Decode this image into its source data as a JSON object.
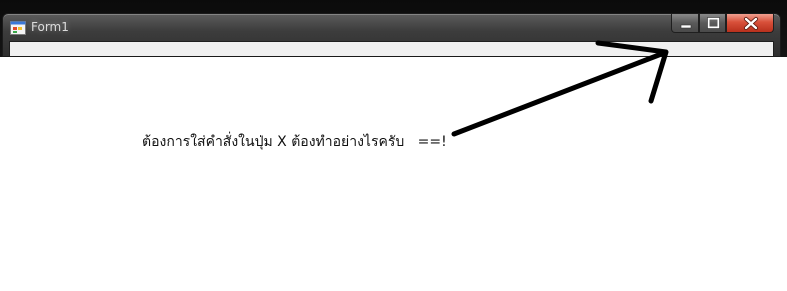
{
  "window": {
    "title": "Form1",
    "controls": {
      "minimize_icon": "minimize-icon",
      "maximize_icon": "maximize-icon",
      "close_icon": "close-icon"
    }
  },
  "annotation": {
    "question": "ต้องการใส่คำสั่งในปุ่ม X ต้องทำอย่างไรครับ   ==!"
  },
  "colors": {
    "close_button": "#d8503a",
    "frame": "#3d3d3d",
    "arrow": "#000000"
  }
}
